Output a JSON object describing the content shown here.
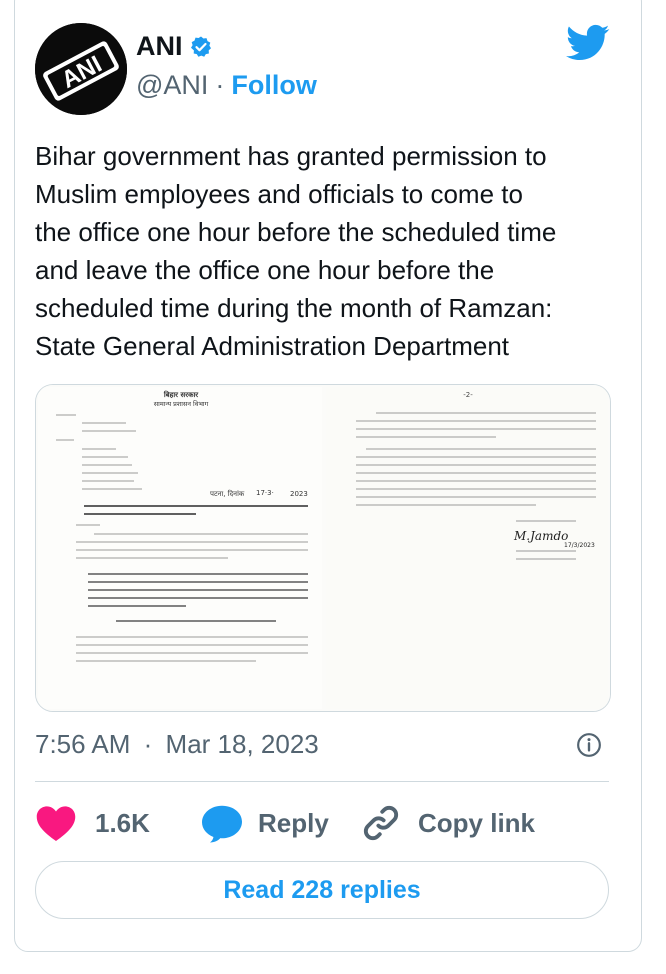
{
  "author": {
    "name": "ANI",
    "handle": "@ANI",
    "separator": "·",
    "follow_label": "Follow",
    "avatar_text": "ANI",
    "verified_icon": "verified-badge-icon"
  },
  "tweet": {
    "lines": [
      "Bihar government has granted permission to",
      "Muslim employees and officials to come to",
      "the office one hour before the scheduled time",
      "and leave the office one hour before the",
      "scheduled time during the month of Ramzan:",
      "State General Administration Department"
    ]
  },
  "media": {
    "alt": "Scanned Bihar government letter",
    "left_header_1": "बिहार सरकार",
    "left_header_2": "सामान्य प्रशासन विभाग",
    "date_label": "पटना, दिनांक",
    "date_value": "17·3·",
    "date_year": "2023",
    "right_page_no": "-2-",
    "signature": "M.Jamdo",
    "signature_date": "17/3/2023"
  },
  "meta": {
    "time": "7:56 AM",
    "separator": "·",
    "date": "Mar 18, 2023"
  },
  "actions": {
    "likes": "1.6K",
    "reply_label": "Reply",
    "copy_label": "Copy link"
  },
  "replies_button": "Read 228 replies",
  "colors": {
    "accent": "#1d9bf0",
    "like": "#f91880",
    "text": "#0f1419",
    "muted": "#536471",
    "border": "#cfd9de"
  }
}
